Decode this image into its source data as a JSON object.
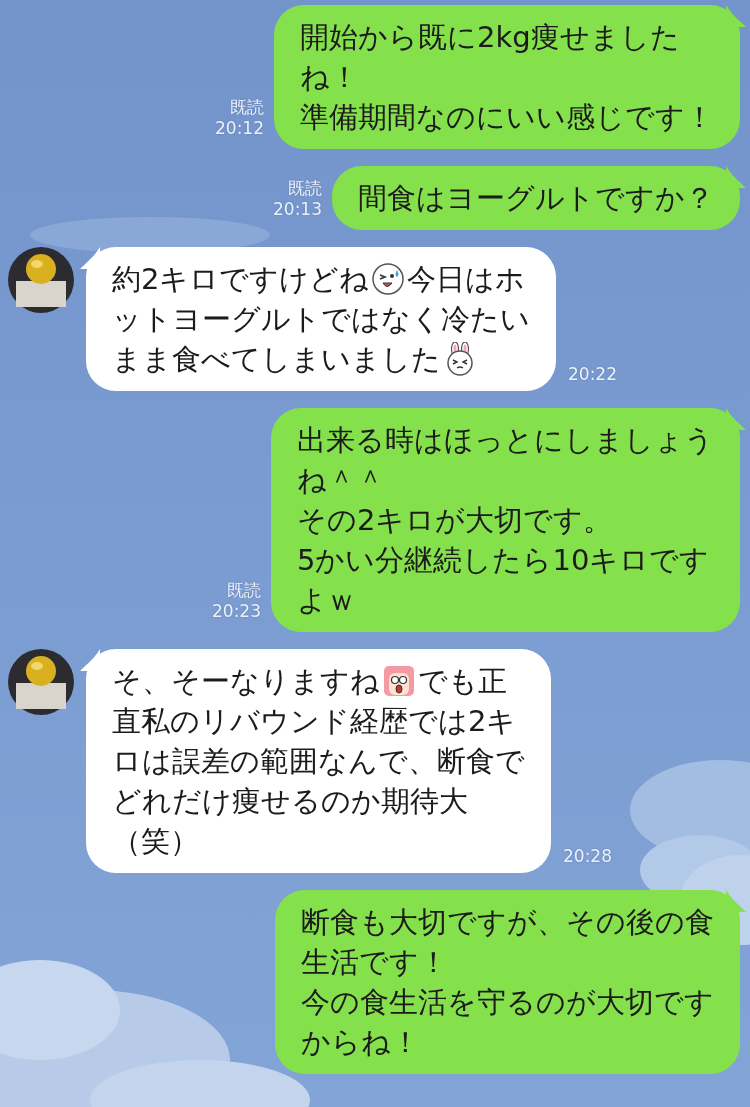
{
  "messages": [
    {
      "kind": "sent",
      "read_label": "既読",
      "time": "20:12",
      "lines": [
        [
          {
            "kind": "text",
            "text": "開始から既に2kg痩せました"
          }
        ],
        [
          {
            "kind": "text",
            "text": "ね！"
          }
        ],
        [
          {
            "kind": "text",
            "text": "準備期間なのにいい感じです！"
          }
        ]
      ]
    },
    {
      "kind": "sent",
      "read_label": "既読",
      "time": "20:13",
      "lines": [
        [
          {
            "kind": "text",
            "text": "間食はヨーグルトですか？"
          }
        ]
      ]
    },
    {
      "kind": "received",
      "time": "20:22",
      "lines": [
        [
          {
            "kind": "text",
            "text": "約2キロですけどね"
          },
          {
            "kind": "wink"
          },
          {
            "kind": "text",
            "text": "今日はホ"
          }
        ],
        [
          {
            "kind": "text",
            "text": "ットヨーグルトではなく冷たい"
          }
        ],
        [
          {
            "kind": "text",
            "text": "まま食べてしまいました"
          },
          {
            "kind": "bunny"
          }
        ]
      ]
    },
    {
      "kind": "sent",
      "read_label": "既読",
      "time": "20:23",
      "lines": [
        [
          {
            "kind": "text",
            "text": "出来る時はほっとにしましょう"
          }
        ],
        [
          {
            "kind": "text",
            "text": "ね＾＾"
          }
        ],
        [
          {
            "kind": "text",
            "text": "その2キロが大切です。"
          }
        ],
        [
          {
            "kind": "text",
            "text": "5かい分継続したら10キロです"
          }
        ],
        [
          {
            "kind": "text",
            "text": "よｗ"
          }
        ]
      ]
    },
    {
      "kind": "received",
      "time": "20:28",
      "lines": [
        [
          {
            "kind": "text",
            "text": "そ、そーなりますね"
          },
          {
            "kind": "girl"
          },
          {
            "kind": "text",
            "text": "でも正"
          }
        ],
        [
          {
            "kind": "text",
            "text": "直私のリバウンド経歴では2キ"
          }
        ],
        [
          {
            "kind": "text",
            "text": "ロは誤差の範囲なんで、断食で"
          }
        ],
        [
          {
            "kind": "text",
            "text": "どれだけ痩せるのか期待大"
          }
        ],
        [
          {
            "kind": "text",
            "text": "（笑）"
          }
        ]
      ]
    },
    {
      "kind": "sent",
      "lines": [
        [
          {
            "kind": "text",
            "text": "断食も大切ですが、その後の食"
          }
        ],
        [
          {
            "kind": "text",
            "text": "生活です！"
          }
        ],
        [
          {
            "kind": "text",
            "text": "今の食生活を守るのが大切です"
          }
        ],
        [
          {
            "kind": "text",
            "text": "からね！"
          }
        ]
      ]
    }
  ]
}
